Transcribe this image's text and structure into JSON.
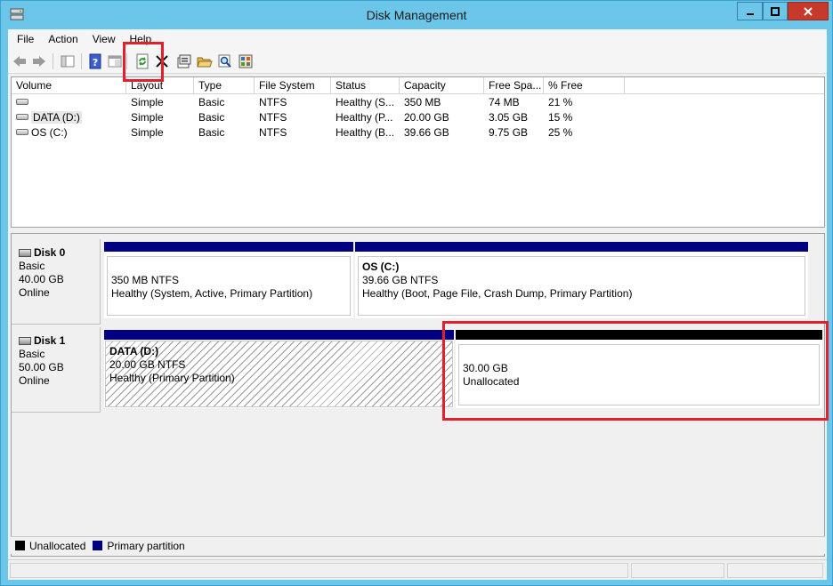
{
  "window": {
    "title": "Disk Management"
  },
  "menu": [
    "File",
    "Action",
    "View",
    "Help"
  ],
  "toolbar": {
    "icons": [
      "back-arrow-icon",
      "forward-arrow-icon",
      "console-tree-icon",
      "help-icon",
      "properties-view-icon",
      "refresh-icon",
      "delete-icon",
      "properties-icon",
      "open-folder-icon",
      "search-icon",
      "explore-icon"
    ]
  },
  "volume_list": {
    "columns": [
      "Volume",
      "Layout",
      "Type",
      "File System",
      "Status",
      "Capacity",
      "Free Spa...",
      "% Free"
    ],
    "rows": [
      [
        "",
        "Simple",
        "Basic",
        "NTFS",
        "Healthy (S...",
        "350 MB",
        "74 MB",
        "21 %"
      ],
      [
        "DATA (D:)",
        "Simple",
        "Basic",
        "NTFS",
        "Healthy (P...",
        "20.00 GB",
        "3.05 GB",
        "15 %"
      ],
      [
        "OS (C:)",
        "Simple",
        "Basic",
        "NTFS",
        "Healthy (B...",
        "39.66 GB",
        "9.75 GB",
        "25 %"
      ]
    ]
  },
  "disks": [
    {
      "name": "Disk 0",
      "type": "Basic",
      "size": "40.00 GB",
      "state": "Online",
      "partitions": [
        {
          "title": "",
          "size": "350 MB NTFS",
          "status": "Healthy (System, Active, Primary Partition)",
          "kind": "primary"
        },
        {
          "title": "OS  (C:)",
          "size": "39.66 GB NTFS",
          "status": "Healthy (Boot, Page File, Crash Dump, Primary Partition)",
          "kind": "primary"
        }
      ]
    },
    {
      "name": "Disk 1",
      "type": "Basic",
      "size": "50.00 GB",
      "state": "Online",
      "partitions": [
        {
          "title": "DATA  (D:)",
          "size": "20.00 GB NTFS",
          "status": "Healthy (Primary Partition)",
          "kind": "primary-selected"
        },
        {
          "title": "",
          "size": "30.00 GB",
          "status": "Unallocated",
          "kind": "unallocated"
        }
      ]
    }
  ],
  "legend": [
    {
      "label": "Unallocated",
      "color": "#000000"
    },
    {
      "label": "Primary partition",
      "color": "#000080"
    }
  ],
  "colors": {
    "primary_bar": "#000080",
    "unallocated_bar": "#000000",
    "highlight": "#e0202a",
    "title_bar": "#6bc6ea"
  }
}
